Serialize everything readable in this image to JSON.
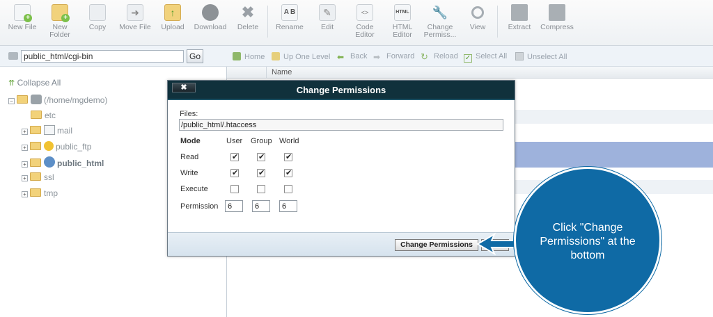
{
  "toolbar": {
    "items": [
      {
        "label": "New File",
        "icon": "new-file-icon"
      },
      {
        "label": "New\nFolder",
        "icon": "new-folder-icon"
      },
      {
        "label": "Copy",
        "icon": "copy-icon"
      },
      {
        "label": "Move File",
        "icon": "move-file-icon"
      },
      {
        "label": "Upload",
        "icon": "upload-icon"
      },
      {
        "label": "Download",
        "icon": "download-icon"
      },
      {
        "label": "Delete",
        "icon": "delete-icon"
      },
      {
        "label": "Rename",
        "icon": "rename-icon"
      },
      {
        "label": "Edit",
        "icon": "edit-icon"
      },
      {
        "label": "Code\nEditor",
        "icon": "code-editor-icon"
      },
      {
        "label": "HTML\nEditor",
        "icon": "html-editor-icon"
      },
      {
        "label": "Change\nPermiss...",
        "icon": "change-permissions-icon"
      },
      {
        "label": "View",
        "icon": "view-icon"
      },
      {
        "label": "Extract",
        "icon": "extract-icon"
      },
      {
        "label": "Compress",
        "icon": "compress-icon"
      }
    ]
  },
  "pathbar": {
    "path_value": "public_html/cgi-bin",
    "go_label": "Go"
  },
  "navbar": {
    "home": "Home",
    "up_one_level": "Up One Level",
    "back": "Back",
    "forward": "Forward",
    "reload": "Reload",
    "select_all": "Select All",
    "unselect_all": "Unselect All"
  },
  "tree": {
    "collapse_all": "Collapse All",
    "root": "(/home/mgdemo)",
    "items": [
      "etc",
      "mail",
      "public_ftp",
      "public_html",
      "ssl",
      "tmp"
    ]
  },
  "filelist": {
    "name_header": "Name"
  },
  "dialog": {
    "title": "Change Permissions",
    "close_label": "✖",
    "files_label": "Files:",
    "files_value": "/public_html/.htaccess",
    "mode_label": "Mode",
    "user_label": "User",
    "group_label": "Group",
    "world_label": "World",
    "read_label": "Read",
    "write_label": "Write",
    "execute_label": "Execute",
    "permission_label": "Permission",
    "perm_user": "6",
    "perm_group": "6",
    "perm_world": "6",
    "change_button": "Change Permissions",
    "checks": {
      "read": [
        true,
        true,
        true
      ],
      "write": [
        true,
        true,
        true
      ],
      "execute": [
        false,
        false,
        false
      ]
    }
  },
  "callout": {
    "text": "Click \"Change Permissions\" at the bottom",
    "color": "#0f6aa5"
  }
}
